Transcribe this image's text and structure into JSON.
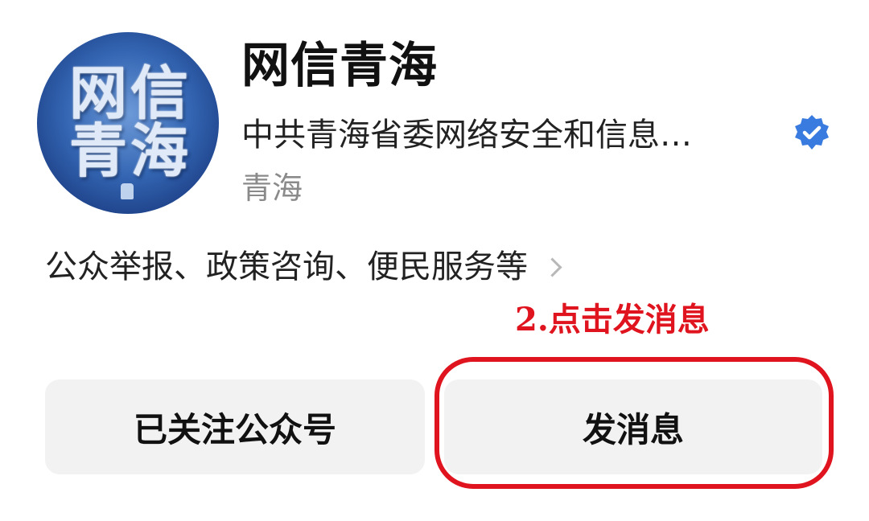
{
  "account": {
    "avatar_glyphs": [
      "网",
      "信",
      "青",
      "海"
    ],
    "name": "网信青海",
    "organization": "中共青海省委网络安全和信息…",
    "verified_icon": "verified-badge-icon",
    "region": "青海"
  },
  "services": {
    "label": "公众举报、政策咨询、便民服务等",
    "icon": "chevron-right-icon"
  },
  "annotation": {
    "text": "2.点击发消息",
    "color": "#e0141e"
  },
  "buttons": {
    "follow_label": "已关注公众号",
    "message_label": "发消息"
  },
  "colors": {
    "verified_blue": "#3a7be0",
    "button_bg": "#f2f2f2",
    "highlight_red": "#e0141e"
  }
}
